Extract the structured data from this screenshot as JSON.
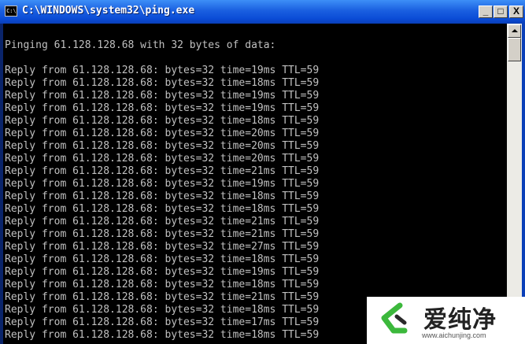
{
  "window": {
    "title": "C:\\WINDOWS\\system32\\ping.exe",
    "icon_label": "C:\\",
    "buttons": {
      "minimize": "_",
      "maximize": "□",
      "close": "X"
    }
  },
  "console": {
    "lines": [
      "",
      "Pinging 61.128.128.68 with 32 bytes of data:",
      "",
      "Reply from 61.128.128.68: bytes=32 time=19ms TTL=59",
      "Reply from 61.128.128.68: bytes=32 time=18ms TTL=59",
      "Reply from 61.128.128.68: bytes=32 time=19ms TTL=59",
      "Reply from 61.128.128.68: bytes=32 time=19ms TTL=59",
      "Reply from 61.128.128.68: bytes=32 time=18ms TTL=59",
      "Reply from 61.128.128.68: bytes=32 time=20ms TTL=59",
      "Reply from 61.128.128.68: bytes=32 time=20ms TTL=59",
      "Reply from 61.128.128.68: bytes=32 time=20ms TTL=59",
      "Reply from 61.128.128.68: bytes=32 time=21ms TTL=59",
      "Reply from 61.128.128.68: bytes=32 time=19ms TTL=59",
      "Reply from 61.128.128.68: bytes=32 time=18ms TTL=59",
      "Reply from 61.128.128.68: bytes=32 time=18ms TTL=59",
      "Reply from 61.128.128.68: bytes=32 time=21ms TTL=59",
      "Reply from 61.128.128.68: bytes=32 time=21ms TTL=59",
      "Reply from 61.128.128.68: bytes=32 time=27ms TTL=59",
      "Reply from 61.128.128.68: bytes=32 time=18ms TTL=59",
      "Reply from 61.128.128.68: bytes=32 time=19ms TTL=59",
      "Reply from 61.128.128.68: bytes=32 time=18ms TTL=59",
      "Reply from 61.128.128.68: bytes=32 time=21ms TTL=59",
      "Reply from 61.128.128.68: bytes=32 time=18ms TTL=59",
      "Reply from 61.128.128.68: bytes=32 time=17ms TTL=59",
      "Reply from 61.128.128.68: bytes=32 time=18ms TTL=59"
    ]
  },
  "watermark": {
    "brand": "爱纯净",
    "url": "www.aichunjing.com",
    "logo_icon": "aichunjing-logo-icon"
  },
  "colors": {
    "title_bar": "#0a4bd6",
    "console_bg": "#000000",
    "console_text": "#c0c0c0",
    "logo_green": "#3cb83c"
  }
}
